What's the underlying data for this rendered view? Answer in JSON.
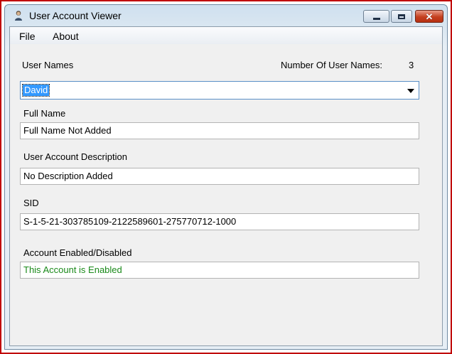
{
  "window": {
    "title": "User Account Viewer"
  },
  "menu": {
    "file": "File",
    "about": "About"
  },
  "labels": {
    "user_names": "User Names",
    "user_count_label": "Number Of User Names:",
    "full_name": "Full Name",
    "description": "User Account Description",
    "sid": "SID",
    "account_status": "Account Enabled/Disabled"
  },
  "user_count": "3",
  "selected_user": "David",
  "fields": {
    "full_name": "Full Name Not Added",
    "description": "No Description Added",
    "sid": "S-1-5-21-303785109-2122589601-275770712-1000",
    "account_status": "This Account is Enabled"
  },
  "colors": {
    "status_enabled": "#1a8a1a",
    "selection": "#3399ff"
  },
  "icons": [
    "user-icon",
    "minimize-icon",
    "maximize-icon",
    "close-icon",
    "dropdown-arrow-icon"
  ]
}
